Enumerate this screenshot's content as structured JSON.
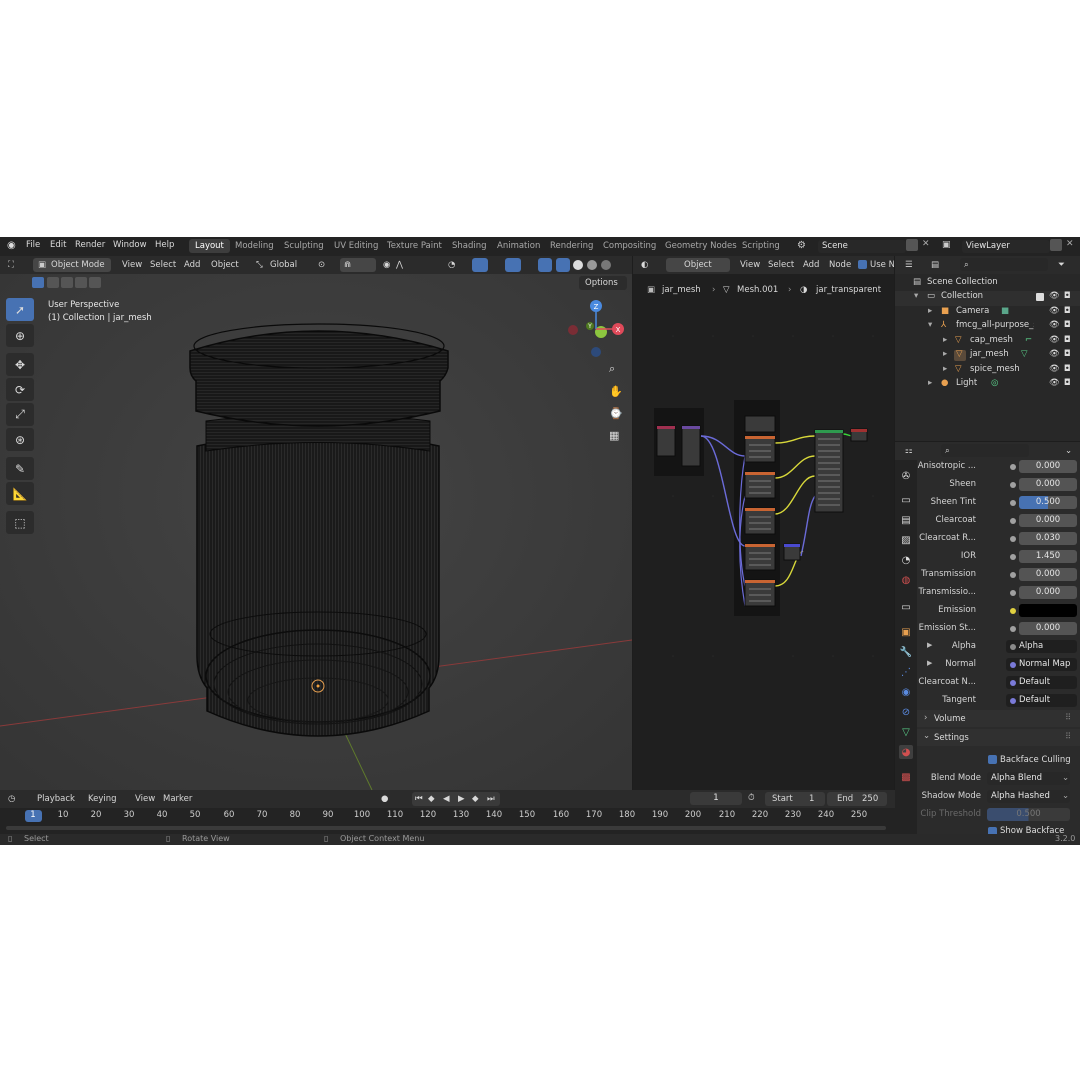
{
  "topbar": {
    "menus": [
      "File",
      "Edit",
      "Render",
      "Window",
      "Help"
    ],
    "workspaces": [
      "Layout",
      "Modeling",
      "Sculpting",
      "UV Editing",
      "Texture Paint",
      "Shading",
      "Animation",
      "Rendering",
      "Compositing",
      "Geometry Nodes",
      "Scripting"
    ],
    "active_workspace": "Layout",
    "scene": "Scene",
    "view_layer": "ViewLayer"
  },
  "viewport": {
    "mode": "Object Mode",
    "menus": [
      "View",
      "Select",
      "Add",
      "Object"
    ],
    "transform_orientation": "Global",
    "options_label": "Options",
    "overlay_title": "User Perspective",
    "overlay_subtitle": "(1) Collection | jar_mesh",
    "gizmo": {
      "x": "X",
      "y": "Y",
      "z": "Z"
    }
  },
  "node_editor": {
    "object_type": "Object",
    "menus": [
      "View",
      "Select",
      "Add",
      "Node"
    ],
    "use_nodes_label": "Use N",
    "breadcrumb": [
      "jar_mesh",
      "Mesh.001",
      "jar_transparent"
    ]
  },
  "outliner": {
    "root": "Scene Collection",
    "items": [
      {
        "label": "Collection",
        "indent": 1
      },
      {
        "label": "Camera",
        "indent": 2
      },
      {
        "label": "fmcg_all-purpose_se",
        "indent": 2
      },
      {
        "label": "cap_mesh",
        "indent": 3
      },
      {
        "label": "jar_mesh",
        "indent": 3
      },
      {
        "label": "spice_mesh",
        "indent": 3
      },
      {
        "label": "Light",
        "indent": 2
      }
    ]
  },
  "properties": {
    "rows": [
      {
        "label": "Anisotropic ...",
        "value": "0.000"
      },
      {
        "label": "Sheen",
        "value": "0.000"
      },
      {
        "label": "Sheen Tint",
        "value": "0.500"
      },
      {
        "label": "Clearcoat",
        "value": "0.000"
      },
      {
        "label": "Clearcoat R...",
        "value": "0.030"
      },
      {
        "label": "IOR",
        "value": "1.450"
      },
      {
        "label": "Transmission",
        "value": "0.000"
      },
      {
        "label": "Transmissio...",
        "value": "0.000"
      },
      {
        "label": "Emission",
        "value": ""
      },
      {
        "label": "Emission St...",
        "value": "0.000"
      }
    ],
    "links": [
      {
        "label": "Alpha",
        "value": "Alpha"
      },
      {
        "label": "Normal",
        "value": "Normal Map"
      },
      {
        "label": "Clearcoat N...",
        "value": "Default"
      },
      {
        "label": "Tangent",
        "value": "Default"
      }
    ],
    "volume_label": "Volume",
    "settings_label": "Settings",
    "backface_culling": "Backface Culling",
    "blend_mode_label": "Blend Mode",
    "blend_mode": "Alpha Blend",
    "shadow_mode_label": "Shadow Mode",
    "shadow_mode": "Alpha Hashed",
    "clip_threshold_label": "Clip Threshold",
    "clip_threshold": "0.500",
    "show_backface": "Show Backface"
  },
  "timeline": {
    "menus": [
      "Playback",
      "Keying",
      "View",
      "Marker"
    ],
    "current_frame": "1",
    "start_label": "Start",
    "start": "1",
    "end_label": "End",
    "end": "250",
    "ticks": [
      "1",
      "10",
      "20",
      "30",
      "40",
      "50",
      "60",
      "70",
      "80",
      "90",
      "100",
      "110",
      "120",
      "130",
      "140",
      "150",
      "160",
      "170",
      "180",
      "190",
      "200",
      "210",
      "220",
      "230",
      "240",
      "250"
    ]
  },
  "status": {
    "select": "Select",
    "rotate_view": "Rotate View",
    "context_menu": "Object Context Menu",
    "version": "3.2.0"
  },
  "colors": {
    "accent": "#4772b3",
    "x_axis": "#e04a5a",
    "y_axis": "#8cc63f",
    "z_axis": "#4a8ae0"
  }
}
